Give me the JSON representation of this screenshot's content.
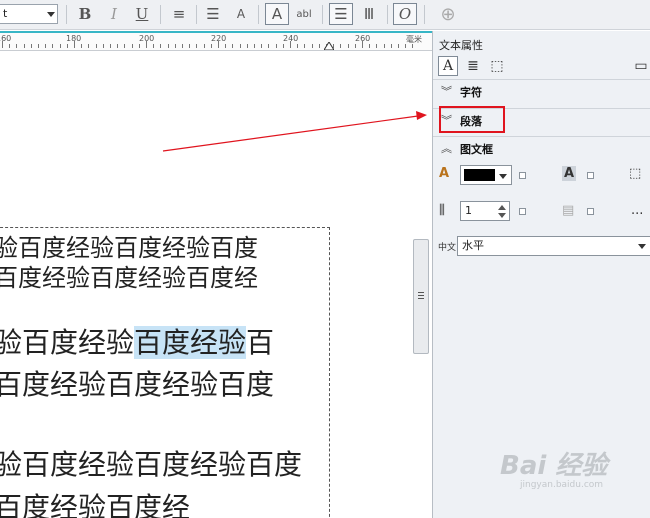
{
  "toolbar": {
    "font_value": "t",
    "bold_glyph": "B",
    "italic_glyph": "I",
    "underline_glyph": "U",
    "align_glyph": "≡",
    "bullets_glyph": "☰",
    "dropcap_glyph": "A",
    "char_style_glyph": "A",
    "abl_glyph": "abl",
    "horizontal_glyph": "☰",
    "vertical_glyph": "Ⅲ",
    "object_glyph": "O",
    "add_glyph": "⊕"
  },
  "ruler": {
    "labels": [
      "160",
      "180",
      "200",
      "220",
      "240",
      "260"
    ],
    "unit": "毫米"
  },
  "document": {
    "line1": "验百度经验百度经验百度",
    "line2": "百度经验百度经验百度经",
    "line3_a": "验百度经验",
    "line3_b": "百度经验",
    "line3_c": "百",
    "line4": "百度经验百度经验百度",
    "line5": "验百度经验百度经验百度",
    "line6": "百度经验百度经"
  },
  "panel": {
    "title": "文本属性",
    "sections": {
      "character": "字符",
      "paragraph": "段落",
      "frame": "图文框"
    },
    "frame": {
      "fill_color": "#000000",
      "columns_value": "1",
      "more_label": "...",
      "direction_value": "水平"
    }
  },
  "watermark": {
    "brand": "Bai  经验",
    "url": "jingyan.baidu.com"
  },
  "colors": {
    "highlight": "#c7e3f6",
    "annotation_red": "#e0141e",
    "ruler_accent": "#38b6c6"
  }
}
